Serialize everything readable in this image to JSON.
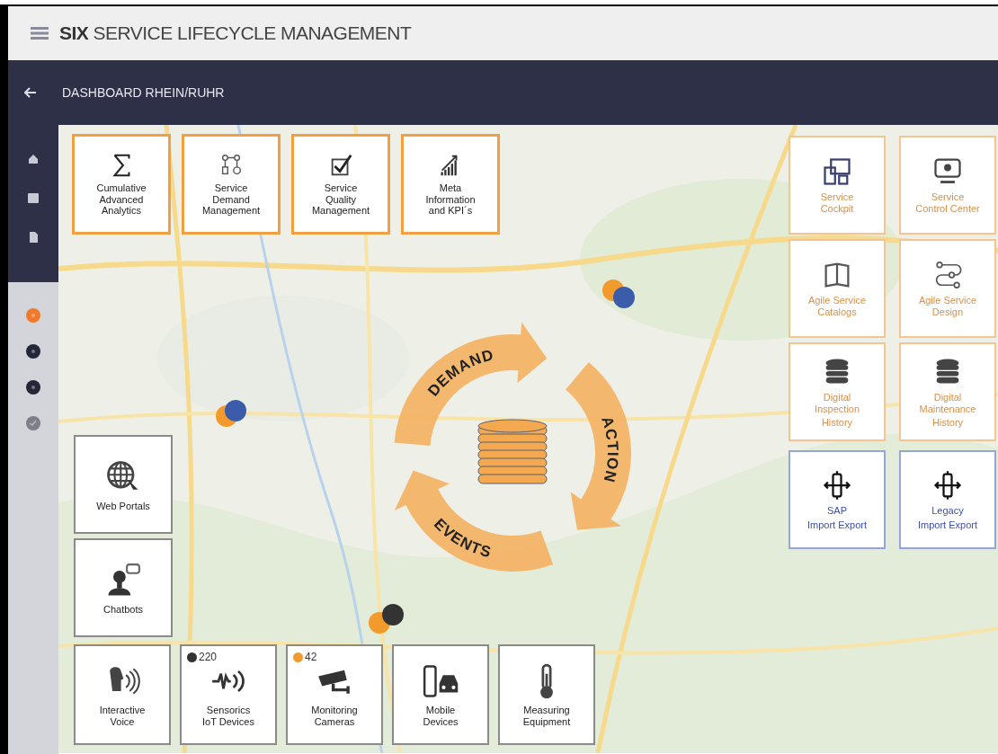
{
  "header": {
    "brand": "SIX",
    "title": "SERVICE LIFECYCLE MANAGEMENT"
  },
  "toolbar": {
    "title": "DASHBOARD RHEIN/RUHR"
  },
  "sidebar": {
    "nav_items": [
      {
        "kind": "home"
      },
      {
        "kind": "gallery"
      },
      {
        "kind": "document"
      }
    ],
    "steps": [
      {
        "kind": "number",
        "selected": true
      },
      {
        "kind": "number",
        "selected": false
      },
      {
        "kind": "number",
        "selected": false
      },
      {
        "kind": "check",
        "selected": false
      }
    ]
  },
  "top_tiles": [
    {
      "label": "Cumulative\nAdvanced\nAnalytics"
    },
    {
      "label": "Service\nDemand\nManagement"
    },
    {
      "label": "Service\nQuality\nManagement"
    },
    {
      "label": "Meta\nInformation\nand KPI´s"
    }
  ],
  "right_tiles": [
    {
      "kind": "service",
      "label": "Service\nCockpit"
    },
    {
      "kind": "service",
      "label": "Service\nControl Center"
    },
    {
      "kind": "service",
      "label": "Agile Service\nCatalogs"
    },
    {
      "kind": "service",
      "label": "Agile Service\nDesign"
    },
    {
      "kind": "service",
      "label": "Digital\nInspection",
      "sublabel": "History"
    },
    {
      "kind": "service",
      "label": "Digital\nMaintenance",
      "sublabel": "History"
    },
    {
      "kind": "interface",
      "label": "SAP",
      "sublabel": "Import Export"
    },
    {
      "kind": "interface",
      "label": "Legacy",
      "sublabel": "Import Export"
    }
  ],
  "channel_tiles": [
    {
      "label": "Web Portals"
    },
    {
      "label": "Chatbots"
    }
  ],
  "device_tiles": [
    {
      "label": "Interactive\nVoice"
    },
    {
      "label": "Sensorics\nIoT Devices",
      "badge": {
        "count": "220",
        "color": "#333333"
      }
    },
    {
      "label": "Monitoring\nCameras",
      "badge": {
        "count": "42",
        "color": "#f39a2c"
      }
    },
    {
      "label": "Mobile\nDevices"
    },
    {
      "label": "Measuring\nEquipment"
    }
  ],
  "cycle": {
    "labels": [
      "DEMAND",
      "ACTION",
      "EVENTS"
    ]
  },
  "map_markers": [
    {
      "color": "#f39a2c"
    },
    {
      "color": "#3b5bab"
    },
    {
      "color": "#f39a2c"
    },
    {
      "color": "#3b5bab"
    },
    {
      "color": "#f39a2c"
    },
    {
      "color": "#333333"
    }
  ]
}
